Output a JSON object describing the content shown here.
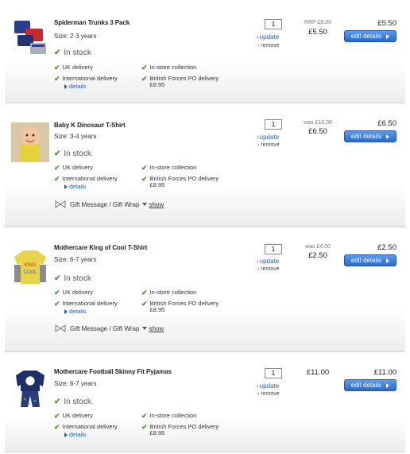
{
  "common": {
    "in_stock": "In stock",
    "uk_delivery": "UK delivery",
    "instore": "In-store collection",
    "international": "International delivery",
    "details": "details",
    "forces": "British Forces PO delivery",
    "forces_price": "£8.95",
    "gift": "Gift Message / Gift Wrap",
    "show": "show",
    "update": "update",
    "remove": "remove",
    "edit": "edit details"
  },
  "items": [
    {
      "title": "Spiderman Trunks 3 Pack",
      "size": "Size: 2-3 years",
      "qty": "1",
      "old_price": "RRP £8.00",
      "price": "£5.50",
      "total": "£5.50"
    },
    {
      "title": "Baby K Dinosaur T-Shirt",
      "size": "Size: 3-4 years",
      "qty": "1",
      "old_price": "was £10.00",
      "price": "£6.50",
      "total": "£6.50"
    },
    {
      "title": "Mothercare King of Cool T-Shirt",
      "size": "Size: 6-7 years",
      "qty": "1",
      "old_price": "was £4.00",
      "price": "£2.50",
      "total": "£2.50"
    },
    {
      "title": "Mothercare Football Skinny Fit Pyjamas",
      "size": "Size: 6-7 years",
      "qty": "1",
      "old_price": "",
      "price": "£11.00",
      "total": "£11.00"
    }
  ]
}
